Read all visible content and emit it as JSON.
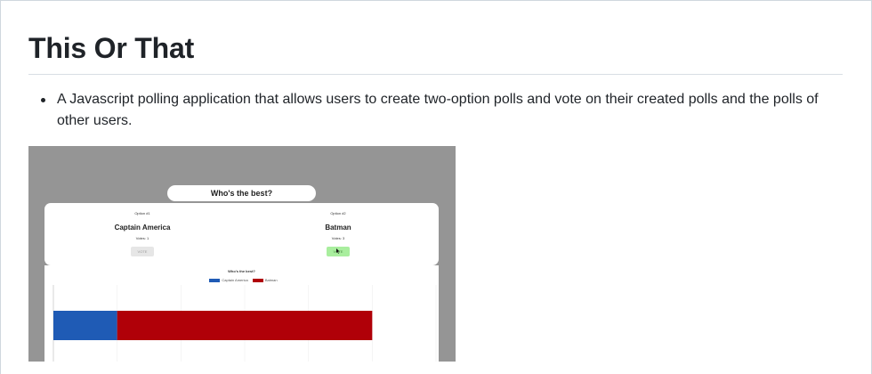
{
  "page": {
    "title": "This Or That",
    "bullets": [
      "A Javascript polling application that allows users to create two-option polls and vote on their created polls and the polls of other users."
    ]
  },
  "screenshot": {
    "question": "Who's the best?",
    "options": [
      {
        "label": "Option #1",
        "name": "Captain America",
        "votes": "Votes: 1",
        "button": "VOTE"
      },
      {
        "label": "Option #2",
        "name": "Batman",
        "votes": "Votes: 3",
        "button": "VOTE"
      }
    ],
    "colors": {
      "captain": "#1f5bb5",
      "batman": "#b00008",
      "vote_active": "#a9ee9e",
      "overlay": "#959595"
    }
  },
  "chart_data": {
    "type": "bar",
    "orientation": "horizontal-stacked",
    "title": "Who's the best?",
    "legend_placement": "top-center",
    "series": [
      {
        "name": "Captain America",
        "values": [
          1
        ],
        "color": "#1f5bb5"
      },
      {
        "name": "Batman",
        "values": [
          4
        ],
        "color": "#b00008"
      }
    ],
    "xlim": [
      0,
      6
    ],
    "grid": true
  }
}
